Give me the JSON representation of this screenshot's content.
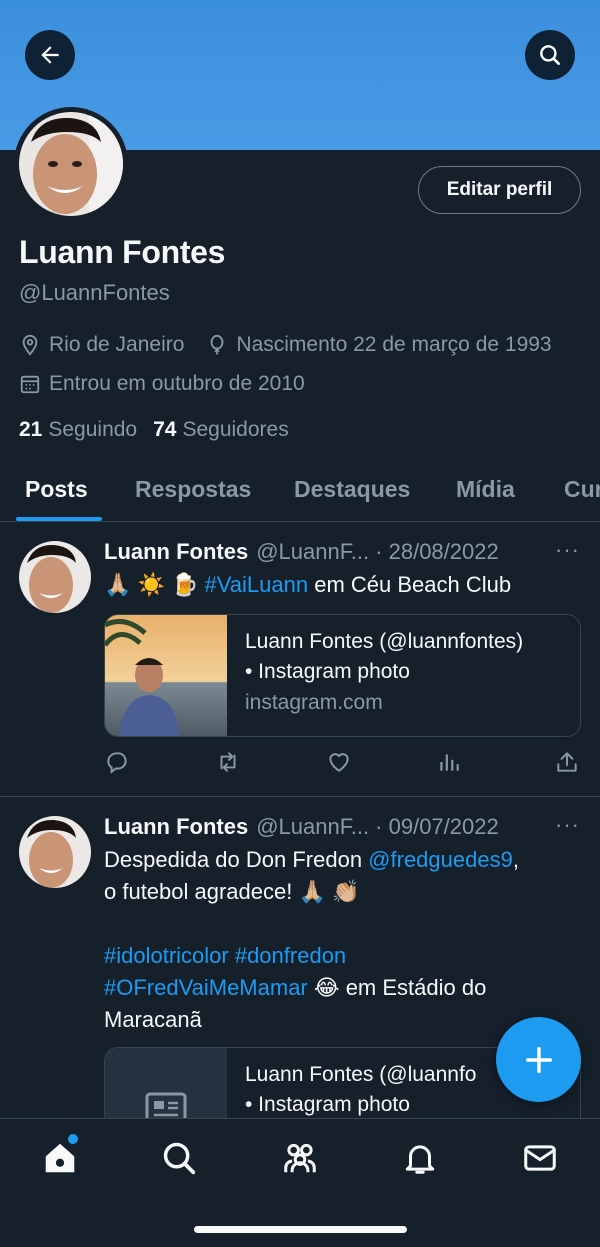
{
  "header": {
    "back_icon": "arrow-left-icon",
    "search_icon": "search-icon",
    "banner_color": "#4a9be6"
  },
  "profile": {
    "name": "Luann Fontes",
    "handle": "@LuannFontes",
    "edit_button": "Editar perfil",
    "location": "Rio de Janeiro",
    "birthday": "Nascimento 22 de março de 1993",
    "joined": "Entrou em outubro de 2010",
    "following_count": "21",
    "following_label": "Seguindo",
    "followers_count": "74",
    "followers_label": "Seguidores"
  },
  "tabs": [
    {
      "label": "Posts",
      "active": true
    },
    {
      "label": "Respostas",
      "active": false
    },
    {
      "label": "Destaques",
      "active": false
    },
    {
      "label": "Mídia",
      "active": false
    },
    {
      "label": "Cur",
      "active": false
    }
  ],
  "posts": [
    {
      "name": "Luann Fontes",
      "handle_date": "@LuannF... · 28/08/2022",
      "more": "···",
      "emoji": "🙏🏼 ☀️ 🍺",
      "hashtag": "#VaiLuann",
      "text_rest": " em Céu Beach Club",
      "card_title_1": "Luann Fontes (@luannfontes)",
      "card_title_2": "• Instagram photo",
      "card_domain": "instagram.com"
    },
    {
      "name": "Luann Fontes",
      "handle_date": "@LuannF... · 09/07/2022",
      "more": "···",
      "line1_a": "Despedida do Don Fredon ",
      "line1_mention": "@fredguedes9",
      "line1_b": ",",
      "line2": "o futebol agradece! 🙏🏼 👏🏼",
      "tags_line1": "#idolotricolor #donfredon",
      "tags_line2_tag": "#OFredVaiMeMamar",
      "tags_line2_rest": " 😂 em Estádio do",
      "line_last": "Maracanã",
      "card_title_1": "Luann Fontes (@luannfo",
      "card_title_2": "• Instagram photo"
    }
  ],
  "accent_color": "#1d9bf0",
  "nav": [
    "home-icon",
    "search-icon",
    "communities-icon",
    "notifications-icon",
    "messages-icon"
  ]
}
